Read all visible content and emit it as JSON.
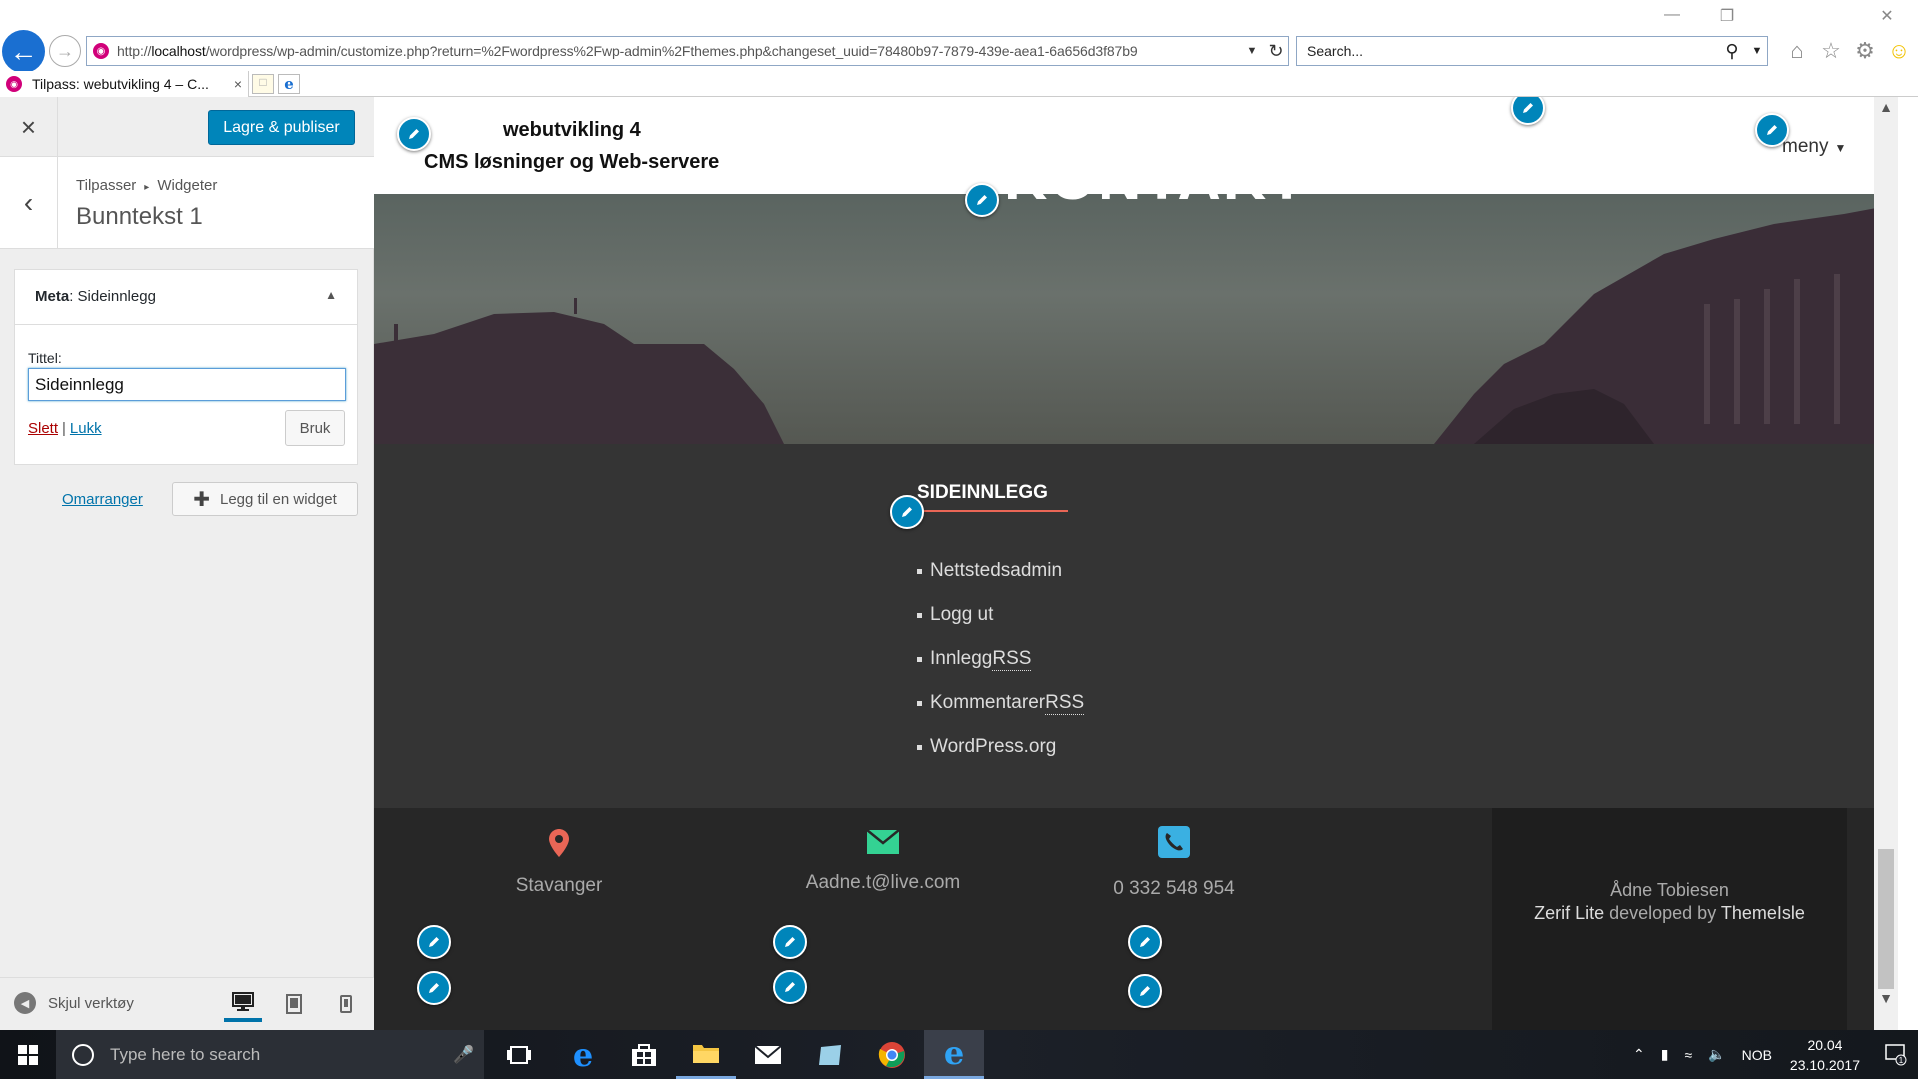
{
  "browser": {
    "address_url_prefix": "http://",
    "address_url_host": "localhost",
    "address_url_rest": "/wordpress/wp-admin/customize.php?return=%2Fwordpress%2Fwp-admin%2Fthemes.php&changeset_uuid=78480b97-7879-439e-aea1-6a656d3f87b9",
    "search_placeholder": "Search...",
    "tab_title": "Tilpass: webutvikling 4 – C...",
    "tab_close": "×",
    "accent_color": "#1a6fd1"
  },
  "sidebar": {
    "close_icon": "×",
    "publish_label": "Lagre & publiser",
    "back_icon": "‹",
    "breadcrumb_root": "Tilpasser",
    "breadcrumb_sep": "▸",
    "breadcrumb_child": "Widgeter",
    "section_title": "Bunntekst 1",
    "widget": {
      "title_prefix": "Meta",
      "title_suffix": ": Sideinnlegg",
      "field_label": "Tittel:",
      "field_value": "Sideinnlegg",
      "delete_label": "Slett",
      "close_label": "Lukk",
      "separator": "|",
      "apply_label": "Bruk"
    },
    "reorder_label": "Omarranger",
    "add_widget_label": "Legg til en widget",
    "hide_controls_label": "Skjul verktøy",
    "publish_color": "#0085ba"
  },
  "preview": {
    "site_title": "webutvikling 4",
    "site_description": "CMS løsninger og Web-servere",
    "menu_label": "meny",
    "hero_title": "KONTAKT",
    "widget_heading": "SIDEINNLEGG",
    "meta_links": [
      {
        "text": "Nettstedsadmin",
        "abbr": ""
      },
      {
        "text": "Logg ut",
        "abbr": ""
      },
      {
        "text": "Innlegg ",
        "abbr": "RSS"
      },
      {
        "text": "Kommentarer ",
        "abbr": "RSS"
      },
      {
        "text": "WordPress.org",
        "abbr": ""
      }
    ],
    "contact": {
      "location": "Stavanger",
      "email": "Aadne.t@live.com",
      "phone": "0 332 548 954"
    },
    "copyright": {
      "author": "Ådne Tobiesen",
      "theme": "Zerif Lite",
      "developed_by": " developed by ",
      "company": "ThemeIsle"
    },
    "heading_underline_color": "#e96656",
    "location_color": "#e96656",
    "email_color": "#34d293",
    "phone_color": "#3ab0e2"
  },
  "taskbar": {
    "search_placeholder": "Type here to search",
    "language": "NOB",
    "time": "20.04",
    "date": "23.10.2017",
    "notification_count": "1"
  }
}
